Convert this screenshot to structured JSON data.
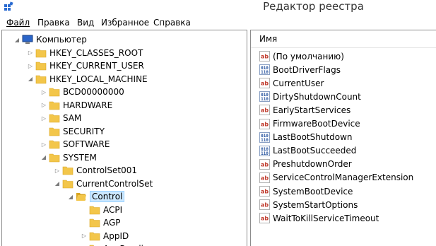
{
  "window": {
    "title": "Редактор реестра"
  },
  "menu": [
    "Файл",
    "Правка",
    "Вид",
    "Избранное",
    "Справка"
  ],
  "tree": [
    {
      "label": "Компьютер",
      "level": 0,
      "expander": "open",
      "icon": "computer-icon"
    },
    {
      "label": "HKEY_CLASSES_ROOT",
      "level": 1,
      "expander": "closed",
      "icon": "folder-icon"
    },
    {
      "label": "HKEY_CURRENT_USER",
      "level": 1,
      "expander": "closed",
      "icon": "folder-icon"
    },
    {
      "label": "HKEY_LOCAL_MACHINE",
      "level": 1,
      "expander": "open",
      "icon": "folder-icon"
    },
    {
      "label": "BCD00000000",
      "level": 2,
      "expander": "closed",
      "icon": "folder-icon"
    },
    {
      "label": "HARDWARE",
      "level": 2,
      "expander": "closed",
      "icon": "folder-icon"
    },
    {
      "label": "SAM",
      "level": 2,
      "expander": "closed",
      "icon": "folder-icon"
    },
    {
      "label": "SECURITY",
      "level": 2,
      "expander": "none",
      "icon": "folder-icon"
    },
    {
      "label": "SOFTWARE",
      "level": 2,
      "expander": "closed",
      "icon": "folder-icon"
    },
    {
      "label": "SYSTEM",
      "level": 2,
      "expander": "open",
      "icon": "folder-icon"
    },
    {
      "label": "ControlSet001",
      "level": 3,
      "expander": "closed",
      "icon": "folder-icon"
    },
    {
      "label": "CurrentControlSet",
      "level": 3,
      "expander": "open",
      "icon": "folder-icon"
    },
    {
      "label": "Control",
      "level": 4,
      "expander": "open",
      "icon": "folder-open-icon",
      "selected": true
    },
    {
      "label": "ACPI",
      "level": 5,
      "expander": "none",
      "icon": "folder-icon"
    },
    {
      "label": "AGP",
      "level": 5,
      "expander": "none",
      "icon": "folder-icon"
    },
    {
      "label": "AppID",
      "level": 5,
      "expander": "closed",
      "icon": "folder-icon"
    },
    {
      "label": "AppReadiness",
      "level": 5,
      "expander": "none",
      "icon": "folder-icon"
    }
  ],
  "values_header": "Имя",
  "values": [
    {
      "name": "(По умолчанию)",
      "type": "string"
    },
    {
      "name": "BootDriverFlags",
      "type": "binary"
    },
    {
      "name": "CurrentUser",
      "type": "string"
    },
    {
      "name": "DirtyShutdownCount",
      "type": "binary"
    },
    {
      "name": "EarlyStartServices",
      "type": "string"
    },
    {
      "name": "FirmwareBootDevice",
      "type": "string"
    },
    {
      "name": "LastBootShutdown",
      "type": "binary"
    },
    {
      "name": "LastBootSucceeded",
      "type": "binary"
    },
    {
      "name": "PreshutdownOrder",
      "type": "string"
    },
    {
      "name": "ServiceControlManagerExtension",
      "type": "string"
    },
    {
      "name": "SystemBootDevice",
      "type": "string"
    },
    {
      "name": "SystemStartOptions",
      "type": "string"
    },
    {
      "name": "WaitToKillServiceTimeout",
      "type": "string"
    }
  ],
  "colors": {
    "folder": "#f3c64a",
    "folder_dark": "#d9a520",
    "string_icon": "#c0392b",
    "binary_icon": "#1f4e9c",
    "selection": "#cce8ff"
  }
}
